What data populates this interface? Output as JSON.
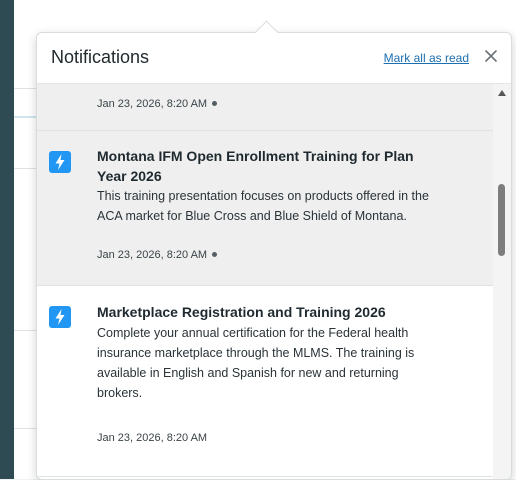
{
  "header": {
    "title": "Notifications",
    "mark_all_label": "Mark all as read"
  },
  "notifications": [
    {
      "timestamp": "Jan 23, 2026, 8:20 AM",
      "unread": true
    },
    {
      "title_line1": "Montana IFM Open Enrollment Training for Plan",
      "title_line2": "Year 2026",
      "body_line1": "This training presentation focuses on products offered in the",
      "body_line2": "ACA market for Blue Cross and Blue Shield of Montana.",
      "timestamp": "Jan 23, 2026, 8:20 AM",
      "unread": true
    },
    {
      "title_line1": "Marketplace Registration and Training 2026",
      "body_line1": "Complete your annual certification for the Federal health",
      "body_line2": "insurance marketplace through the MLMS. The training is",
      "body_line3": "available in English and Spanish for new and returning",
      "body_line4": "brokers.",
      "timestamp": "Jan 23, 2026, 8:20 AM",
      "unread": false
    }
  ],
  "icons": {
    "notification_type": "lightning-bolt-icon",
    "close": "close-icon"
  },
  "colors": {
    "accent": "#2196f3",
    "link": "#1d6fb0",
    "unread_bg": "#efefef"
  }
}
